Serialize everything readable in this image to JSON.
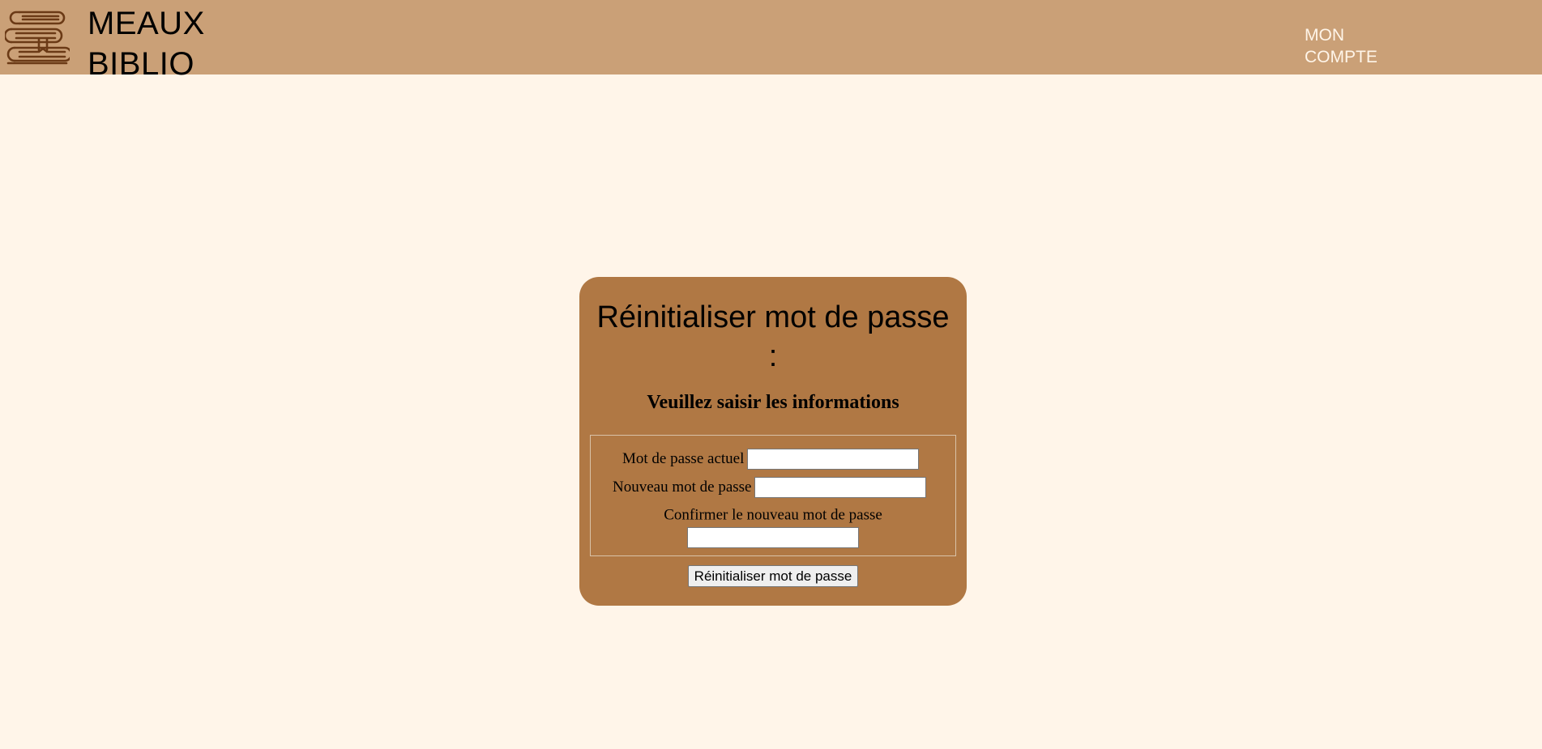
{
  "header": {
    "brand_line1": "MEAUX",
    "brand_line2": "BIBLIO",
    "logo_icon": "books-stack-icon",
    "account_line1": "MON",
    "account_line2": "COMPTE"
  },
  "form": {
    "title_line1": "Réinitialiser mot de passe",
    "title_line2": ":",
    "subtitle": "Veuillez saisir les informations",
    "current_password_label": "Mot de passe actuel",
    "current_password_value": "",
    "new_password_label": "Nouveau mot de passe",
    "new_password_value": "",
    "confirm_password_label": "Confirmer le nouveau mot de passe",
    "confirm_password_value": "",
    "submit_label": "Réinitialiser mot de passe"
  },
  "colors": {
    "page_background": "#fff5e9",
    "header_background": "#caa077",
    "card_background": "#b07844",
    "account_text": "#fff5e9",
    "logo_stroke": "#6b3a16"
  }
}
